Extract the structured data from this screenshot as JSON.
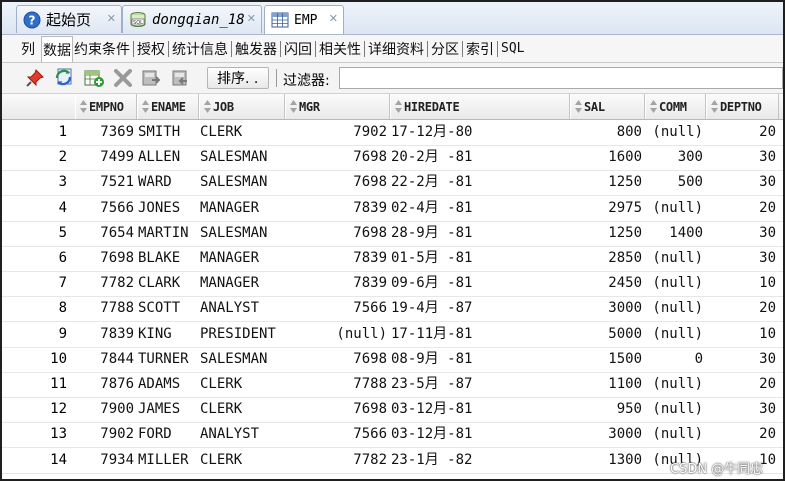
{
  "doc_tabs": [
    {
      "label": "起始页",
      "icon": "help-icon",
      "style": "normal",
      "active": false
    },
    {
      "label": "dongqian_18",
      "icon": "sql-worksheet-icon",
      "style": "italic",
      "active": false
    },
    {
      "label": "EMP",
      "icon": "table-grid-icon",
      "style": "mono",
      "active": true
    }
  ],
  "sub_tabs": [
    "列",
    "数据",
    "约束条件",
    "授权",
    "统计信息",
    "触发器",
    "闪回",
    "相关性",
    "详细资料",
    "分区",
    "索引",
    "SQL"
  ],
  "active_sub_tab": "数据",
  "toolbar": {
    "icons": [
      "pin-icon",
      "refresh-icon",
      "insert-row-icon",
      "delete-row-icon",
      "commit-icon",
      "rollback-icon"
    ],
    "sort_label": "排序. .",
    "filter_label": "过滤器:",
    "filter_value": ""
  },
  "table": {
    "columns": [
      "EMPNO",
      "ENAME",
      "JOB",
      "MGR",
      "HIREDATE",
      "SAL",
      "COMM",
      "DEPTNO"
    ],
    "rows": [
      {
        "n": "1",
        "cells": [
          "7369",
          "SMITH",
          "CLERK",
          "7902",
          "17-12月-80",
          "800",
          "(null)",
          "20"
        ]
      },
      {
        "n": "2",
        "cells": [
          "7499",
          "ALLEN",
          "SALESMAN",
          "7698",
          "20-2月 -81",
          "1600",
          "300",
          "30"
        ]
      },
      {
        "n": "3",
        "cells": [
          "7521",
          "WARD",
          "SALESMAN",
          "7698",
          "22-2月 -81",
          "1250",
          "500",
          "30"
        ]
      },
      {
        "n": "4",
        "cells": [
          "7566",
          "JONES",
          "MANAGER",
          "7839",
          "02-4月 -81",
          "2975",
          "(null)",
          "20"
        ]
      },
      {
        "n": "5",
        "cells": [
          "7654",
          "MARTIN",
          "SALESMAN",
          "7698",
          "28-9月 -81",
          "1250",
          "1400",
          "30"
        ]
      },
      {
        "n": "6",
        "cells": [
          "7698",
          "BLAKE",
          "MANAGER",
          "7839",
          "01-5月 -81",
          "2850",
          "(null)",
          "30"
        ]
      },
      {
        "n": "7",
        "cells": [
          "7782",
          "CLARK",
          "MANAGER",
          "7839",
          "09-6月 -81",
          "2450",
          "(null)",
          "10"
        ]
      },
      {
        "n": "8",
        "cells": [
          "7788",
          "SCOTT",
          "ANALYST",
          "7566",
          "19-4月 -87",
          "3000",
          "(null)",
          "20"
        ]
      },
      {
        "n": "9",
        "cells": [
          "7839",
          "KING",
          "PRESIDENT",
          "(null)",
          "17-11月-81",
          "5000",
          "(null)",
          "10"
        ]
      },
      {
        "n": "10",
        "cells": [
          "7844",
          "TURNER",
          "SALESMAN",
          "7698",
          "08-9月 -81",
          "1500",
          "0",
          "30"
        ]
      },
      {
        "n": "11",
        "cells": [
          "7876",
          "ADAMS",
          "CLERK",
          "7788",
          "23-5月 -87",
          "1100",
          "(null)",
          "20"
        ]
      },
      {
        "n": "12",
        "cells": [
          "7900",
          "JAMES",
          "CLERK",
          "7698",
          "03-12月-81",
          "950",
          "(null)",
          "30"
        ]
      },
      {
        "n": "13",
        "cells": [
          "7902",
          "FORD",
          "ANALYST",
          "7566",
          "03-12月-81",
          "3000",
          "(null)",
          "20"
        ]
      },
      {
        "n": "14",
        "cells": [
          "7934",
          "MILLER",
          "CLERK",
          "7782",
          "23-1月 -82",
          "1300",
          "(null)",
          "10"
        ]
      }
    ]
  },
  "watermark": "CSDN @牛同忠"
}
